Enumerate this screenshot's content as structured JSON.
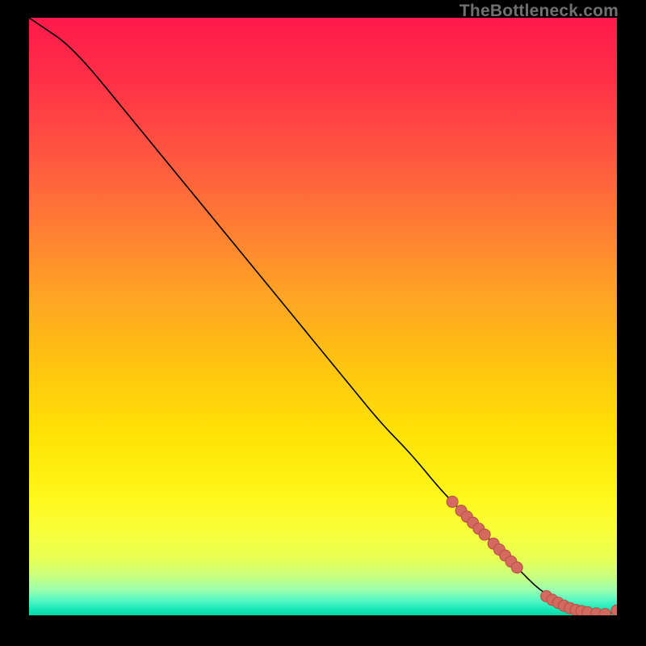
{
  "watermark": "TheBottleneck.com",
  "gradient": {
    "stops": [
      {
        "offset": 0.0,
        "color": "#ff1a4b"
      },
      {
        "offset": 0.1,
        "color": "#ff2f47"
      },
      {
        "offset": 0.22,
        "color": "#ff5340"
      },
      {
        "offset": 0.34,
        "color": "#ff7a35"
      },
      {
        "offset": 0.46,
        "color": "#ffa225"
      },
      {
        "offset": 0.58,
        "color": "#ffc411"
      },
      {
        "offset": 0.7,
        "color": "#ffe305"
      },
      {
        "offset": 0.8,
        "color": "#fff71a"
      },
      {
        "offset": 0.86,
        "color": "#f7ff3a"
      },
      {
        "offset": 0.905,
        "color": "#e9ff55"
      },
      {
        "offset": 0.935,
        "color": "#c8ff80"
      },
      {
        "offset": 0.958,
        "color": "#9bffb0"
      },
      {
        "offset": 0.975,
        "color": "#55f7c4"
      },
      {
        "offset": 0.99,
        "color": "#17e8b8"
      },
      {
        "offset": 1.0,
        "color": "#04d8a4"
      }
    ]
  },
  "chart_data": {
    "type": "line",
    "title": "",
    "xlabel": "",
    "ylabel": "",
    "xlim": [
      0,
      100
    ],
    "ylim": [
      0,
      100
    ],
    "grid": false,
    "legend": false,
    "series": [
      {
        "name": "curve",
        "x": [
          0,
          3,
          6,
          10,
          15,
          20,
          25,
          30,
          35,
          40,
          45,
          50,
          55,
          60,
          65,
          70,
          74,
          78,
          82,
          84,
          86,
          88,
          90,
          92,
          94,
          96,
          98,
          100
        ],
        "y": [
          100,
          98,
          96,
          92,
          86,
          80,
          74,
          68,
          62,
          56,
          50,
          44,
          38,
          32,
          27,
          21,
          17,
          13,
          9,
          7,
          5,
          3.5,
          2.3,
          1.4,
          0.8,
          0.4,
          0.2,
          0.6
        ]
      }
    ],
    "markers": [
      {
        "name": "cluster-upper",
        "x": [
          72,
          73.5,
          74.5,
          75.5,
          76.5,
          77.5
        ],
        "y": [
          19,
          17.5,
          16.5,
          15.5,
          14.5,
          13.5
        ]
      },
      {
        "name": "cluster-mid",
        "x": [
          79,
          80,
          81,
          82,
          83
        ],
        "y": [
          12,
          11,
          10,
          9,
          8
        ]
      },
      {
        "name": "cluster-low",
        "x": [
          88,
          89,
          90,
          91,
          92,
          93,
          94,
          95,
          96.5,
          98
        ],
        "y": [
          3.2,
          2.6,
          2.1,
          1.6,
          1.2,
          0.9,
          0.7,
          0.5,
          0.3,
          0.2
        ]
      },
      {
        "name": "end-uptick",
        "x": [
          100
        ],
        "y": [
          0.8
        ]
      }
    ],
    "marker_style": {
      "r": 7,
      "fill": "#d46a5f",
      "stroke": "#b44f45"
    },
    "line_style": {
      "stroke": "#000000",
      "width": 1.6
    }
  }
}
